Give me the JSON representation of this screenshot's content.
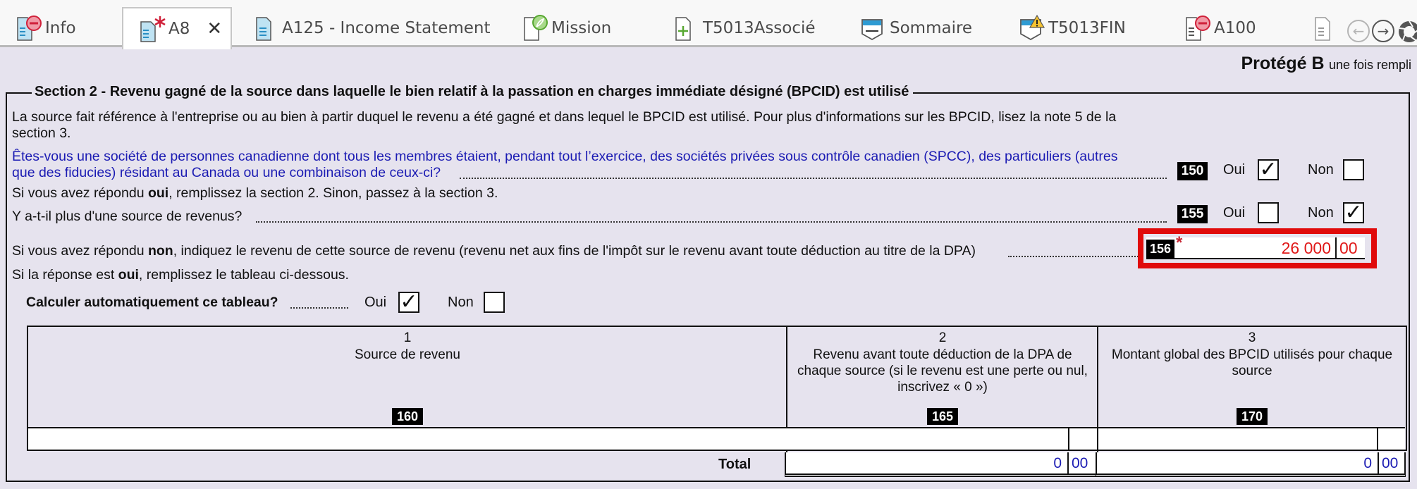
{
  "tabs": [
    {
      "label": "Info",
      "icon": "document-error-icon",
      "active": false
    },
    {
      "label": "A8",
      "icon": "document-modified-icon",
      "active": true,
      "close_label": "✕"
    },
    {
      "label": "A125 - Income Statement",
      "icon": "document-icon",
      "active": false
    },
    {
      "label": "Mission",
      "icon": "document-feather-icon",
      "active": false
    },
    {
      "label": "T5013Associé",
      "icon": "document-add-icon",
      "active": false
    },
    {
      "label": "Sommaire",
      "icon": "summary-icon",
      "active": false
    },
    {
      "label": "T5013FIN",
      "icon": "summary-warning-icon",
      "active": false
    },
    {
      "label": "A100",
      "icon": "document-error-icon",
      "active": false
    },
    {
      "label": "",
      "icon": "document-icon",
      "active": false
    }
  ],
  "nav": {
    "back": "←",
    "forward": "→"
  },
  "protected": {
    "bold": "Protégé B",
    "suffix": "une fois rempli"
  },
  "section": {
    "title": "Section 2 - Revenu gagné de la source dans laquelle le bien relatif à la passation en charges immédiate désigné (BPCID) est utilisé",
    "intro_line1": "La source fait référence à l'entreprise ou au bien à partir duquel le revenu a été gagné et dans lequel le BPCID est utilisé. Pour plus d'informations sur les BPCID, lisez la note 5 de la",
    "intro_line2": "section 3.",
    "q150": {
      "line1": "Êtes-vous une société de personnes canadienne dont tous les membres étaient, pendant tout l’exercice, des sociétés privées sous contrôle canadien (SPCC), des particuliers (autres",
      "line2": "que des fiducies) résidant au Canada ou une combinaison de ceux-ci?",
      "code": "150",
      "oui_label": "Oui",
      "non_label": "Non",
      "oui_checked": "✓",
      "non_checked": ""
    },
    "note_oui_pre": "Si vous avez répondu ",
    "note_oui_bold": "oui",
    "note_oui_post": ", remplissez la section 2. Sinon, passez à la section 3.",
    "q155": {
      "text": "Y a-t-il plus d'une source de revenus?",
      "code": "155",
      "oui_label": "Oui",
      "non_label": "Non",
      "oui_checked": "",
      "non_checked": "✓"
    },
    "q156": {
      "pre": "Si vous avez répondu ",
      "bold": "non",
      "post": ", indiquez le revenu de cette source de revenu (revenu net aux fins de l'impôt sur le revenu avant toute déduction au titre de la DPA)",
      "code": "156",
      "required_mark": "*",
      "value": "26 000",
      "cents": "00"
    },
    "note_table_pre": "Si la réponse est ",
    "note_table_bold": "oui",
    "note_table_post": ", remplissez le tableau ci-dessous.",
    "auto_calc": {
      "label": "Calculer automatiquement ce tableau?",
      "oui_label": "Oui",
      "non_label": "Non",
      "oui_checked": "✓",
      "non_checked": ""
    },
    "table": {
      "columns": [
        {
          "num": "1",
          "desc": "Source de revenu",
          "code": "160"
        },
        {
          "num": "2",
          "desc": "Revenu avant toute déduction de la DPA de chaque source (si le revenu est une perte ou nul, inscrivez « 0 »)",
          "code": "165"
        },
        {
          "num": "3",
          "desc": "Montant global des BPCID utilisés pour chaque source",
          "code": "170"
        }
      ],
      "total_label": "Total",
      "total_165": {
        "value": "0",
        "cents": "00"
      },
      "total_170": {
        "value": "0",
        "cents": "00"
      }
    }
  },
  "colors": {
    "highlight": "#e00b0b",
    "value_red": "#e01818",
    "link_blue": "#1b1bb3"
  }
}
